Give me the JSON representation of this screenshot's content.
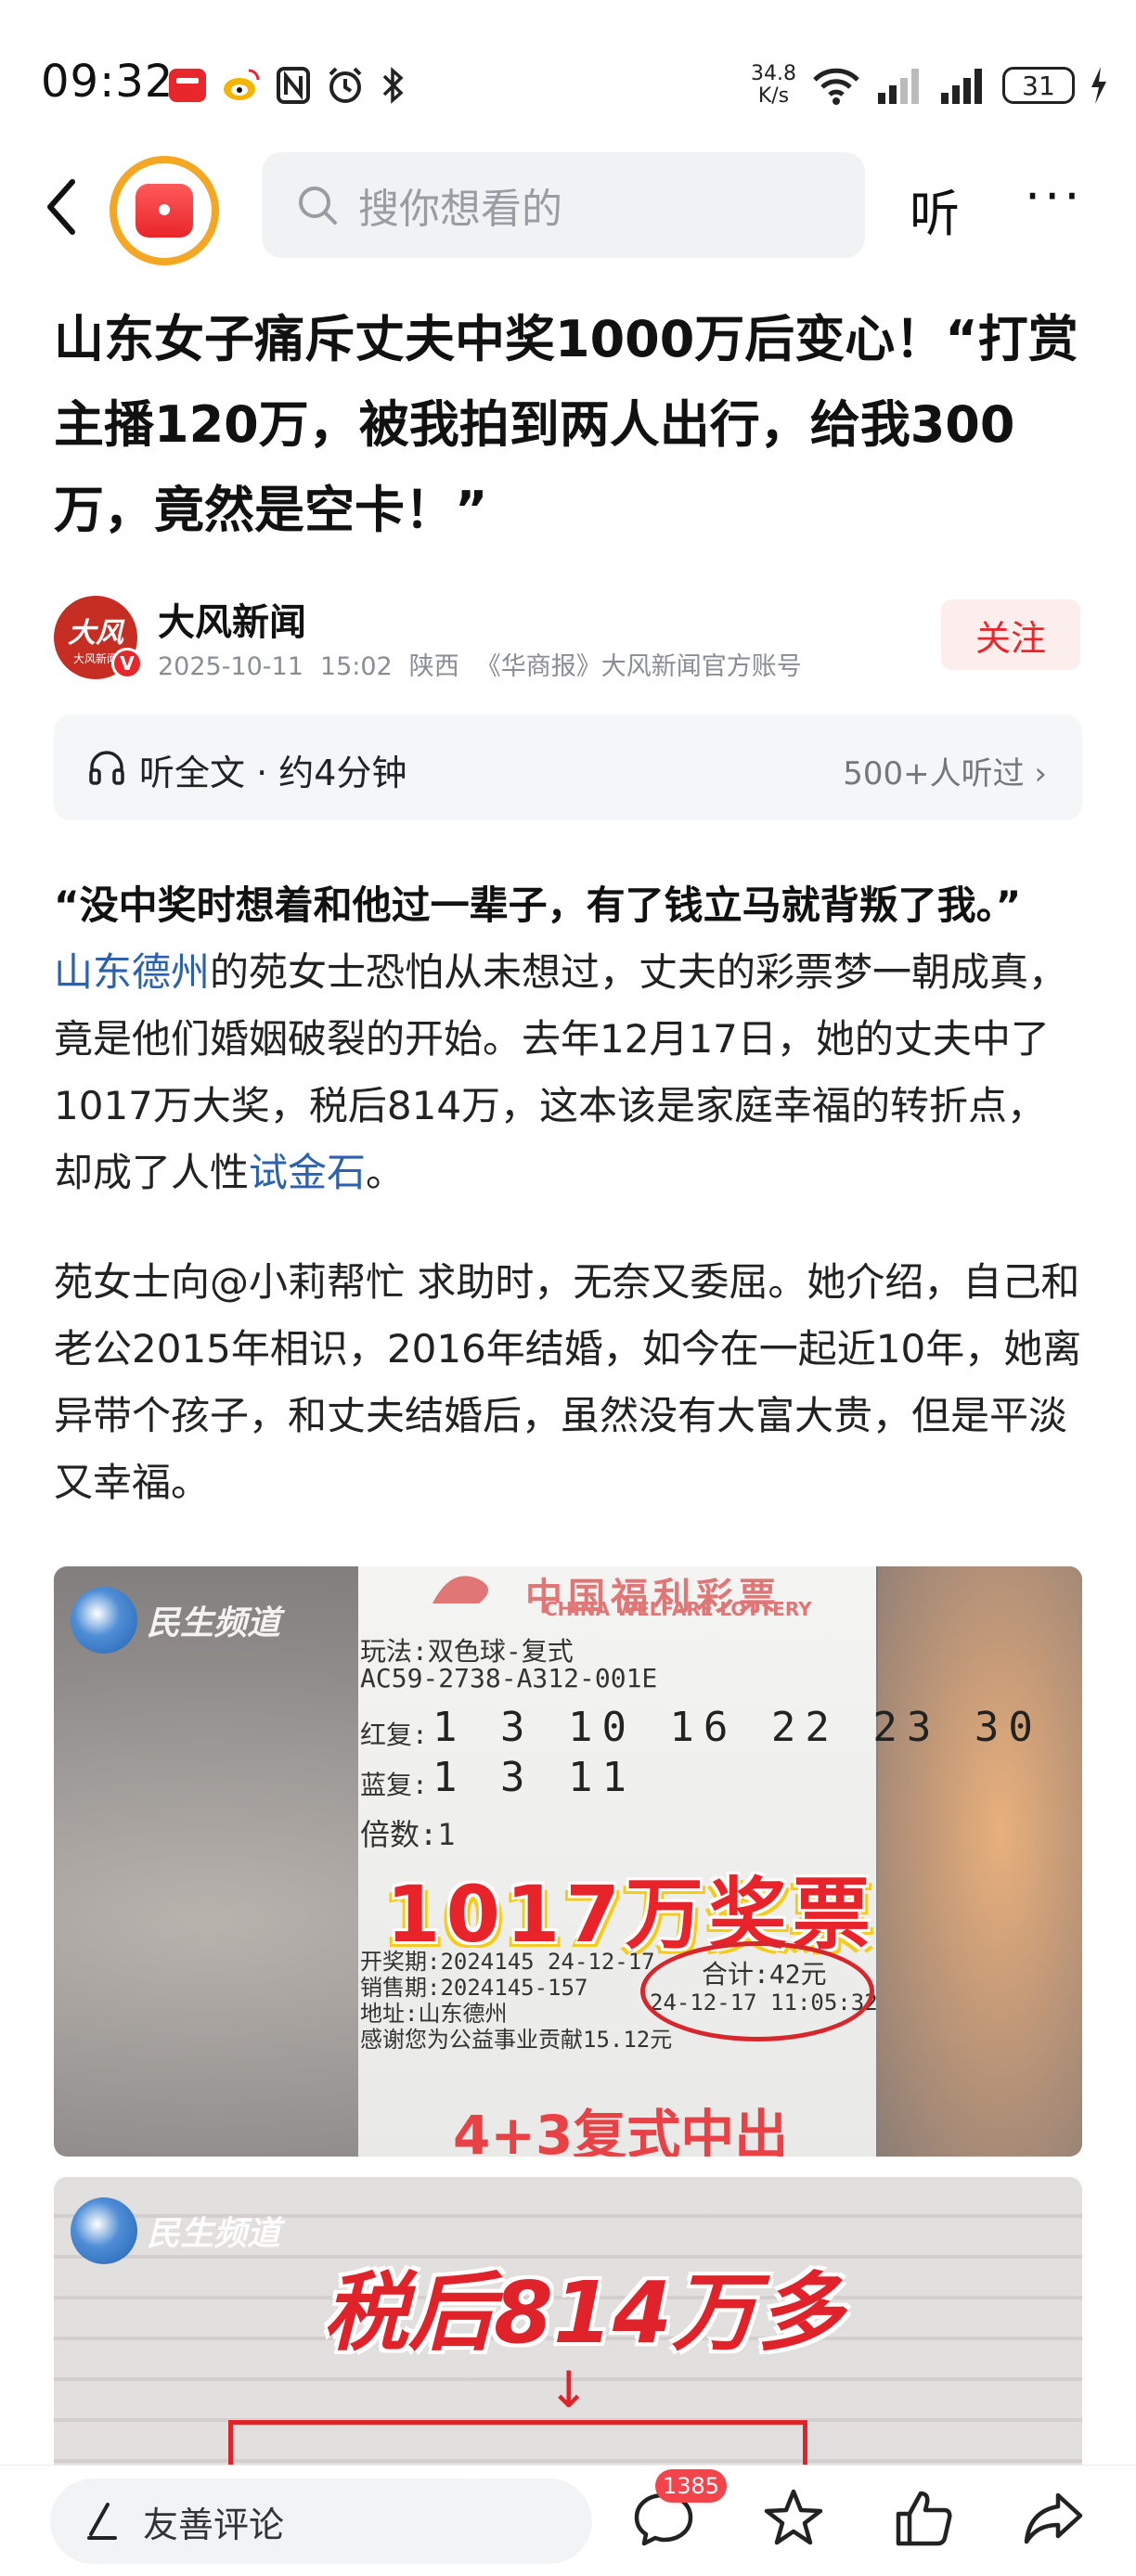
{
  "status_bar": {
    "time": "09:32",
    "net_speed_value": "34.8",
    "net_speed_unit": "K/s",
    "battery": "31"
  },
  "nav": {
    "search_placeholder": "搜你想看的",
    "listen_label": "听",
    "more_label": "···"
  },
  "article": {
    "title": "山东女子痛斥丈夫中奖1000万后变心！“打赏主播120万，被我拍到两人出行，给我300万，竟然是空卡！”",
    "author": {
      "name": "大风新闻",
      "avatar_text": "大风",
      "avatar_sub": "大风新闻",
      "verified_mark": "V",
      "date": "2025-10-11",
      "time": "15:02",
      "region": "陕西",
      "source": "《华商报》大风新闻官方账号",
      "follow_label": "关注"
    },
    "listen_bar": {
      "label": "听全文 · 约4分钟",
      "listeners": "500+人听过 ›"
    },
    "p1_quote": "“没中奖时想着和他过一辈子，有了钱立马就背叛了我。”",
    "p1_link1": "山东德州",
    "p1_text1": "的苑女士恐怕从未想过，丈夫的彩票梦一朝成真，竟是他们婚姻破裂的开始。去年12月17日，她的丈夫中了1017万大奖，税后814万，这本该是家庭幸福的转折点，却成了人性",
    "p1_link2": "试金石",
    "p1_end": "。",
    "p2": "苑女士向@小莉帮忙 求助时，无奈又委屈。她介绍，自己和老公2015年相识，2016年结婚，如今在一起近10年，她离异带个孩子，和丈夫结婚后，虽然没有大富大贵，但是平淡又幸福。"
  },
  "image1": {
    "channel": "民生频道",
    "lottery_cn": "中国福利彩票",
    "lottery_en": "CHINA WELFARE LOTTERY",
    "play_type": "玩法:双色球-复式",
    "ticket_id": "AC59-2738-A312-001E",
    "red_label": "红复:",
    "red_numbers": "1 3 10 16 22 23 30",
    "blue_label": "蓝复:",
    "blue_numbers": "1 3 11",
    "multiple": "倍数:1",
    "headline": "1017万奖票",
    "draw_period": "开奖期:2024145 24-12-17",
    "sale_period": "销售期:2024145-157",
    "address": "地址:山东德州",
    "thanks": "感谢您为公益事业贡献15.12元",
    "total": "合计:42元",
    "datetime": "24-12-17 11:05:32",
    "bottom_caption": "4+3复式中出"
  },
  "image2": {
    "channel": "民生频道",
    "headline": "税后814万多",
    "arrow": "↓"
  },
  "bottom_bar": {
    "comment_placeholder": "友善评论",
    "comment_count": "1385"
  }
}
